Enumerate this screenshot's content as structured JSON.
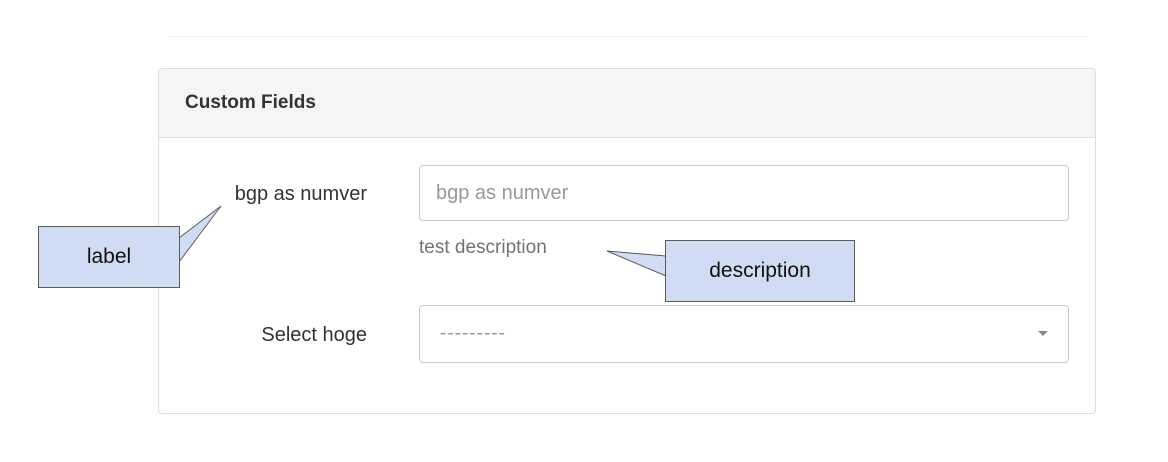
{
  "panel": {
    "title": "Custom Fields"
  },
  "fields": {
    "bgp": {
      "label": "bgp as numver",
      "placeholder": "bgp as numver",
      "value": "",
      "description": "test description"
    },
    "select": {
      "label": "Select hoge",
      "selected": "---------"
    }
  },
  "annotations": {
    "label_callout": "label",
    "description_callout": "description",
    "fill_color": "#cfdcf3",
    "border_color": "#5b5b5b"
  },
  "icons": {
    "select_arrow": "caret-down-icon"
  }
}
